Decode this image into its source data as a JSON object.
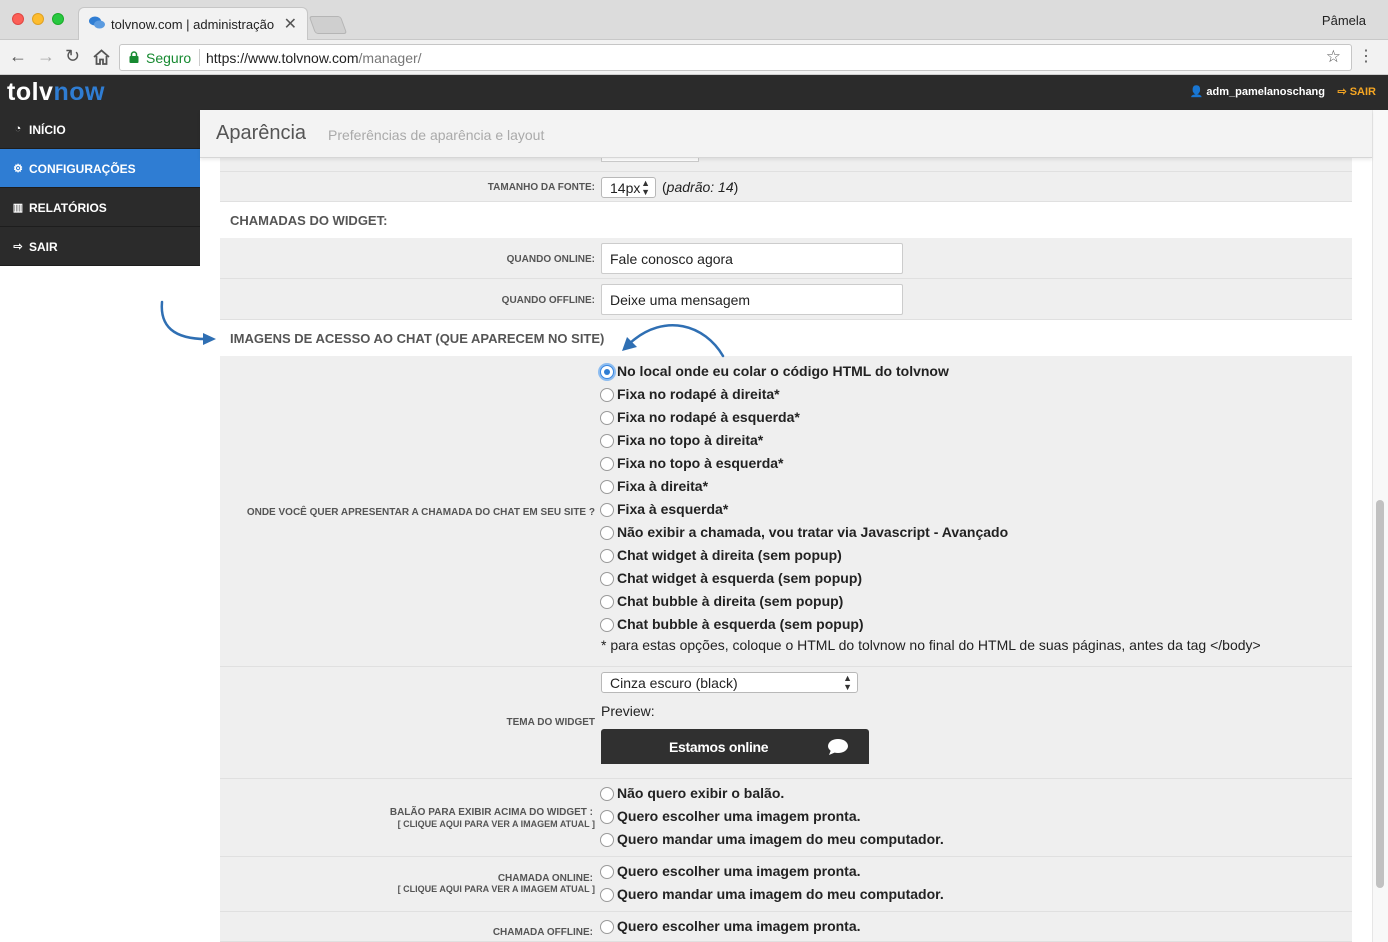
{
  "browser": {
    "tab_title": "tolvnow.com | administração",
    "tab_close": "✕",
    "profile": "Pâmela",
    "secure_label": "Seguro",
    "url_host": "https://www.tolvnow.com",
    "url_path": "/manager/",
    "icons": [
      "back-icon",
      "forward-icon",
      "reload-icon",
      "home-icon",
      "lock-icon",
      "star-icon",
      "menu-icon",
      "chat-bubbles-icon"
    ]
  },
  "header": {
    "logo_a": "tolv",
    "logo_b": "now",
    "user": "adm_pamelanoschang",
    "logout": "SAIR"
  },
  "sidebar": {
    "items": [
      {
        "label": "INÍCIO",
        "icon": "dashboard-icon"
      },
      {
        "label": "CONFIGURAÇÕES",
        "icon": "gears-icon"
      },
      {
        "label": "RELATÓRIOS",
        "icon": "bar-chart-icon"
      },
      {
        "label": "SAIR",
        "icon": "sign-out-icon"
      }
    ]
  },
  "page": {
    "title": "Aparência",
    "subtitle": "Preferências de aparência e layout"
  },
  "form": {
    "font_size_label": "TAMANHO DA FONTE:",
    "font_size_value": "14px",
    "font_size_hint_prefix": "(",
    "font_size_hint_italic": "padrão: 14",
    "font_size_hint_suffix": ")",
    "section_widget_calls": "CHAMADAS DO WIDGET:",
    "online_label": "QUANDO ONLINE:",
    "online_value": "Fale conosco agora",
    "offline_label": "QUANDO OFFLINE:",
    "offline_value": "Deixe uma mensagem",
    "section_images": "IMAGENS DE ACESSO AO CHAT (QUE APARECEM NO SITE)",
    "position_label": "ONDE VOCÊ QUER APRESENTAR A CHAMADA DO CHAT EM SEU SITE ?",
    "position_options": [
      "No local onde eu colar o código HTML do tolvnow",
      "Fixa no rodapé à direita*",
      "Fixa no rodapé à esquerda*",
      "Fixa no topo à direita*",
      "Fixa no topo à esquerda*",
      "Fixa à direita*",
      "Fixa à esquerda*",
      "Não exibir a chamada, vou tratar via Javascript - Avançado",
      "Chat widget à direita (sem popup)",
      "Chat widget à esquerda (sem popup)",
      "Chat bubble à direita (sem popup)",
      "Chat bubble à esquerda (sem popup)"
    ],
    "position_selected": 0,
    "position_note": "* para estas opções, coloque o HTML do tolvnow no final do HTML de suas páginas, antes da tag </body>",
    "theme_label": "TEMA DO WIDGET",
    "theme_value": "Cinza escuro (black)",
    "preview_label": "Preview:",
    "preview_text": "Estamos online",
    "balloon_label": "BALÃO PARA EXIBIR ACIMA DO WIDGET :",
    "balloon_link": "[ CLIQUE AQUI PARA VER A IMAGEM ATUAL ]",
    "balloon_options": [
      "Não quero exibir o balão.",
      "Quero escolher uma imagem pronta.",
      "Quero mandar uma imagem do meu computador."
    ],
    "online_call_label": "CHAMADA ONLINE:",
    "online_call_link": "[ CLIQUE AQUI PARA VER A IMAGEM ATUAL ]",
    "online_call_options": [
      "Quero escolher uma imagem pronta.",
      "Quero mandar uma imagem do meu computador."
    ],
    "offline_call_label": "CHAMADA OFFLINE:",
    "offline_call_options": [
      "Quero escolher uma imagem pronta."
    ]
  },
  "colors": {
    "accent": "#2f7dd3",
    "header_bg": "#2b2b2b",
    "logout": "#f5a623",
    "annotation_arrow": "#2f6fb3"
  }
}
